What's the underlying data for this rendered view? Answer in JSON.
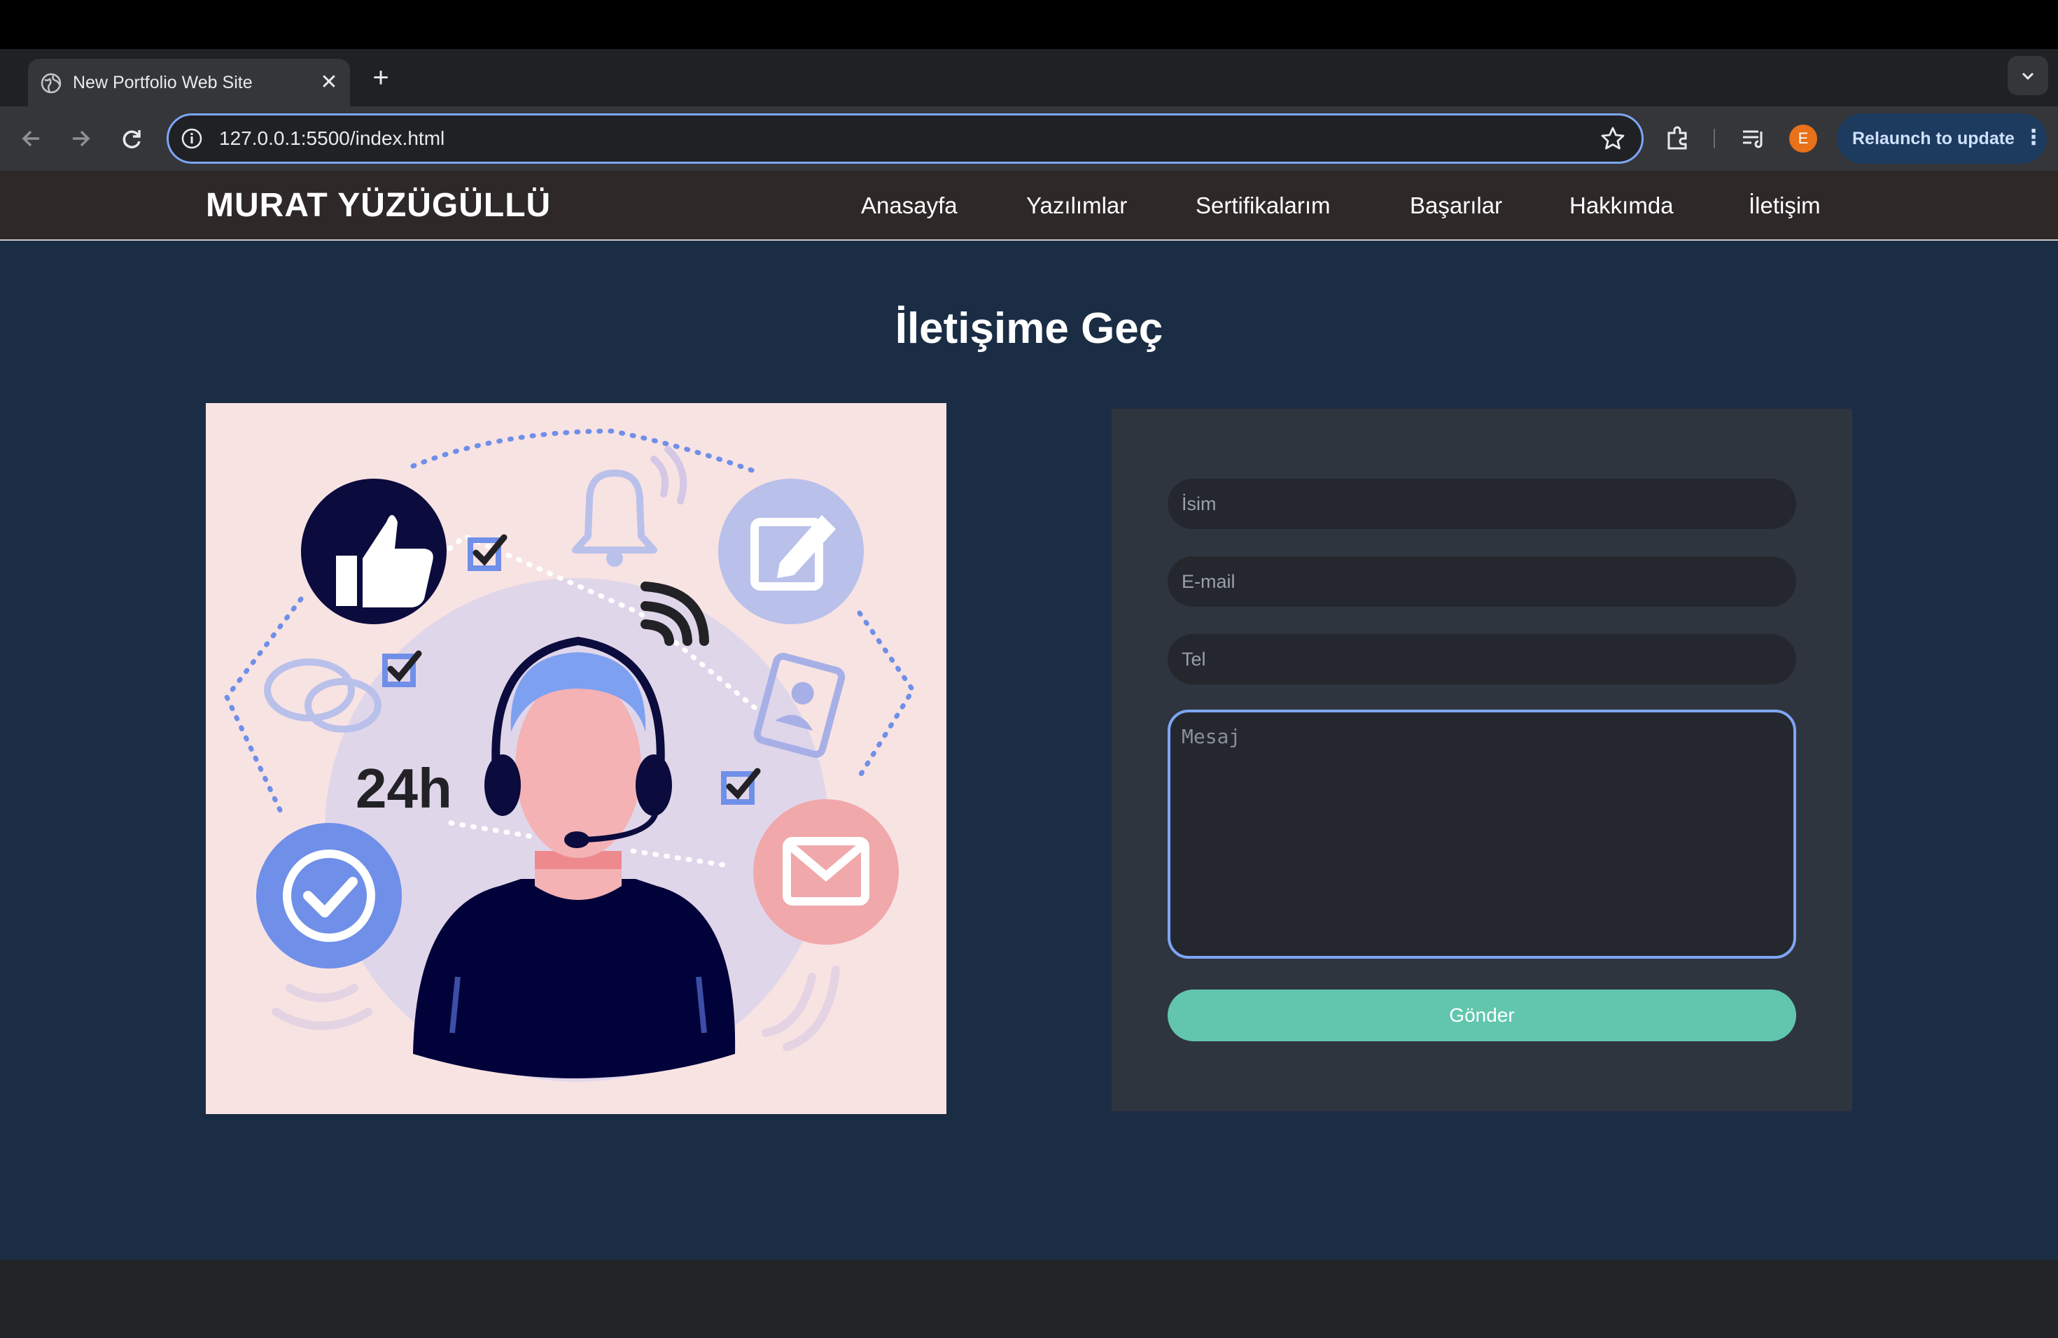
{
  "browser": {
    "tab_title": "New Portfolio Web Site",
    "tab_close": "✕",
    "new_tab": "+",
    "tab_search": "⌄",
    "url": "127.0.0.1:5500/index.html",
    "profile_initial": "E",
    "relaunch_label": "Relaunch to update",
    "menu_glyph": "⋮",
    "accent": "#7ea6f5"
  },
  "site": {
    "brand": "MURAT YÜZÜGÜLLÜ",
    "nav": [
      "Anasayfa",
      "Yazılımlar",
      "Sertifikalarım",
      "Başarılar",
      "Hakkımda",
      "İletişim"
    ]
  },
  "contact": {
    "title": "İletişime Geç",
    "illustration_text": "24h",
    "form": {
      "name_placeholder": "İsim",
      "email_placeholder": "E-mail",
      "phone_placeholder": "Tel",
      "message_placeholder": "Mesaj",
      "submit_label": "Gönder"
    },
    "button_color": "#62c6ae"
  }
}
